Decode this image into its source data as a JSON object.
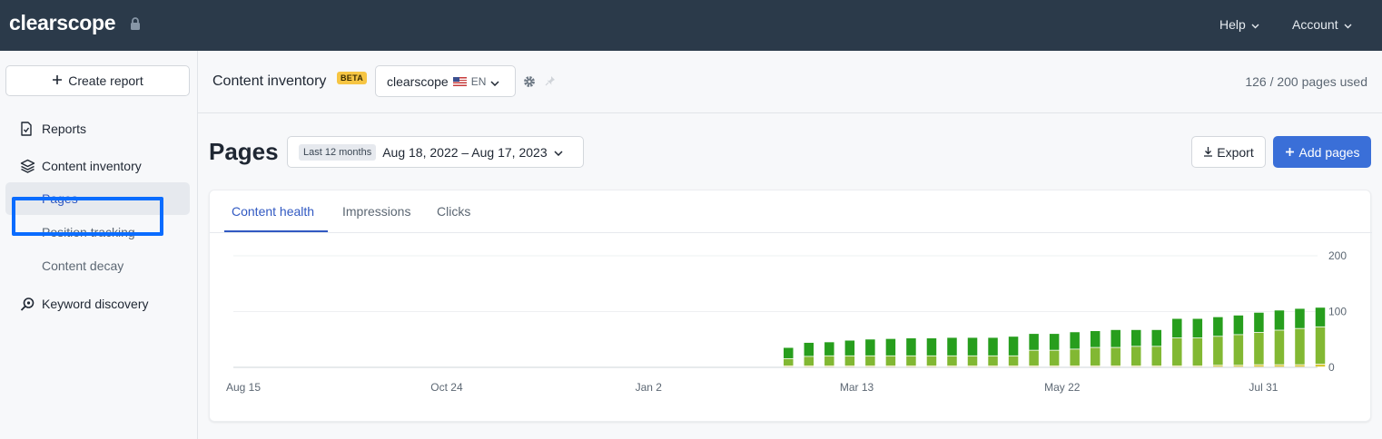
{
  "topbar": {
    "logo": "clearscope",
    "help": "Help",
    "account": "Account"
  },
  "sidebar": {
    "create_report": "Create report",
    "reports": "Reports",
    "content_inventory": "Content inventory",
    "pages": "Pages",
    "position_tracking": "Position tracking",
    "content_decay": "Content decay",
    "keyword_discovery": "Keyword discovery"
  },
  "header": {
    "title": "Content inventory",
    "beta": "BETA",
    "site": "clearscope",
    "lang": "EN",
    "usage": "126 / 200 pages used"
  },
  "pages": {
    "title": "Pages",
    "date_preset": "Last 12 months",
    "date_range": "Aug 18, 2022 – Aug 17, 2023",
    "export": "Export",
    "add_pages": "Add pages"
  },
  "tabs": [
    "Content health",
    "Impressions",
    "Clicks"
  ],
  "colors": {
    "dark_green": "#279e1d",
    "light_green": "#82b833",
    "yellow": "#d7c532",
    "accent": "#3a6fd8",
    "topbar": "#2b3a4a"
  },
  "chart_data": {
    "type": "bar",
    "stacked": true,
    "x_tick_labels": [
      "Aug 15",
      "Oct 24",
      "Jan 2",
      "Mar 13",
      "May 22",
      "Jul 31"
    ],
    "y_tick_labels": [
      "200",
      "100",
      "0"
    ],
    "ylim": [
      0,
      200
    ],
    "grid": true,
    "first_bar_week": 27,
    "total_weeks": 53,
    "series": [
      {
        "color": "yellow",
        "values": [
          2,
          2,
          2,
          2,
          2,
          2,
          2,
          2,
          2,
          2,
          2,
          2,
          2,
          2,
          2,
          2,
          2,
          2,
          2,
          2,
          2,
          3,
          3,
          4,
          4,
          4,
          5
        ]
      },
      {
        "color": "light_green",
        "values": [
          13,
          17,
          18,
          18,
          18,
          18,
          18,
          18,
          18,
          18,
          18,
          18,
          28,
          28,
          30,
          33,
          33,
          35,
          35,
          50,
          50,
          52,
          55,
          58,
          62,
          65,
          67
        ]
      },
      {
        "color": "dark_green",
        "values": [
          20,
          25,
          25,
          28,
          30,
          31,
          32,
          32,
          33,
          33,
          33,
          35,
          30,
          30,
          31,
          30,
          32,
          30,
          30,
          35,
          35,
          35,
          35,
          36,
          36,
          36,
          35
        ]
      }
    ]
  }
}
